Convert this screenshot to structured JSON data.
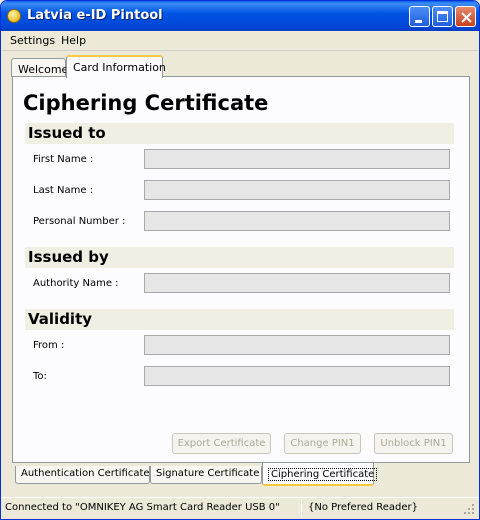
{
  "window": {
    "title": "Latvia e-ID Pintool"
  },
  "menu": [
    "Settings",
    "Help"
  ],
  "top_tabs": {
    "welcome": "Welcome",
    "card": "Card Information"
  },
  "panel": {
    "heading": "Ciphering Certificate",
    "issued_to": {
      "title": "Issued to",
      "first_name_label": "First Name :",
      "first_name_value": "",
      "last_name_label": "Last Name :",
      "last_name_value": "",
      "personal_number_label": "Personal Number :",
      "personal_number_value": ""
    },
    "issued_by": {
      "title": "Issued by",
      "authority_label": "Authority Name :",
      "authority_value": ""
    },
    "validity": {
      "title": "Validity",
      "from_label": "From :",
      "from_value": "",
      "to_label": "To:",
      "to_value": ""
    },
    "buttons": {
      "export": "Export Certificate",
      "change_pin": "Change PIN1",
      "unblock_pin": "Unblock PIN1"
    }
  },
  "bottom_tabs": {
    "auth": "Authentication Certificate",
    "signature": "Signature Certificate",
    "ciphering": "Ciphering Certificate"
  },
  "status": {
    "reader": "Connected to \"OMNIKEY AG Smart Card Reader USB 0\"",
    "preferred": "{No Prefered Reader}"
  },
  "colors": {
    "titlebar": "#0055e5",
    "active_tab_accent": "#ffc83c",
    "section_band": "#f0efe3"
  }
}
